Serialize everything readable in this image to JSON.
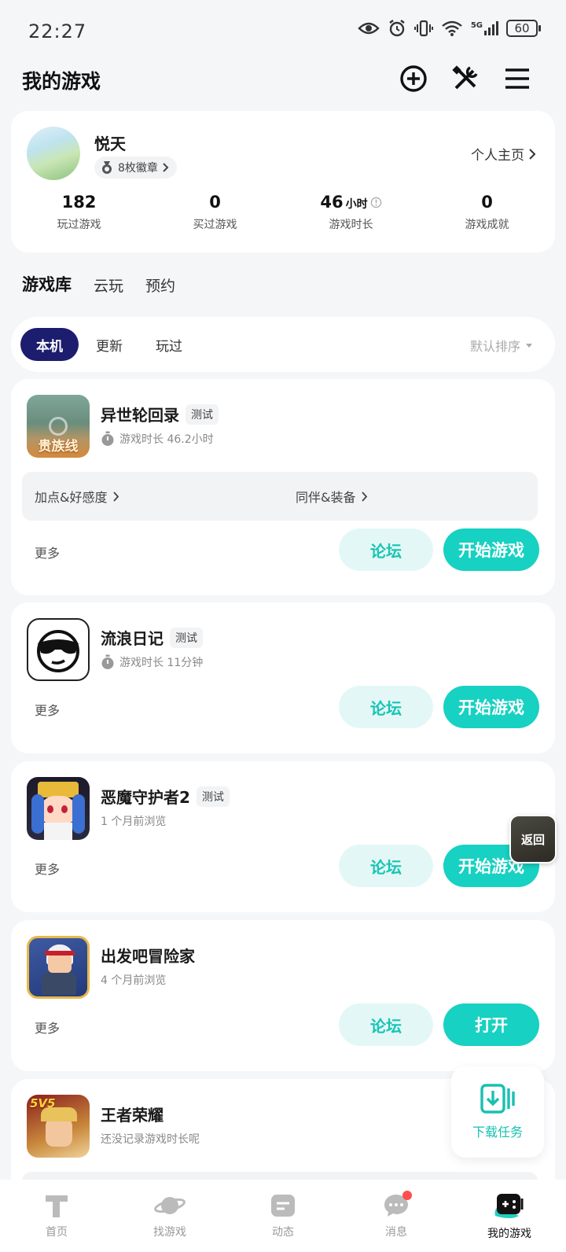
{
  "status_bar": {
    "time": "22:27",
    "battery": "60",
    "network": "5G"
  },
  "header": {
    "title": "我的游戏"
  },
  "profile": {
    "name": "悦天",
    "badge": "8枚徽章",
    "homepage": "个人主页",
    "stats": [
      {
        "value": "182",
        "unit": "",
        "label": "玩过游戏"
      },
      {
        "value": "0",
        "unit": "",
        "label": "买过游戏"
      },
      {
        "value": "46",
        "unit": "小时",
        "label": "游戏时长"
      },
      {
        "value": "0",
        "unit": "",
        "label": "游戏成就"
      }
    ]
  },
  "tabs": [
    "游戏库",
    "云玩",
    "预约"
  ],
  "filters": {
    "chips": [
      "本机",
      "更新",
      "玩过"
    ],
    "sort": "默认排序"
  },
  "games": [
    {
      "name": "异世轮回录",
      "tag": "测试",
      "sub": "游戏时长 46.2小时",
      "links": [
        "加点&好感度",
        "同伴&装备"
      ],
      "more": "更多",
      "forum": "论坛",
      "action": "开始游戏",
      "icon_text": "贵族线"
    },
    {
      "name": "流浪日记",
      "tag": "测试",
      "sub": "游戏时长 11分钟",
      "more": "更多",
      "forum": "论坛",
      "action": "开始游戏"
    },
    {
      "name": "恶魔守护者2",
      "tag": "测试",
      "sub": "1 个月前浏览",
      "more": "更多",
      "forum": "论坛",
      "action": "开始游戏"
    },
    {
      "name": "出发吧冒险家",
      "tag": "",
      "sub": "4 个月前浏览",
      "more": "更多",
      "forum": "论坛",
      "action": "打开"
    },
    {
      "name": "王者荣耀",
      "tag": "",
      "sub": "还没记录游戏时长呢",
      "icon_text": "5V5"
    }
  ],
  "floating": {
    "back": "返回",
    "download": "下载任务"
  },
  "nav": [
    {
      "label": "首页",
      "icon": "home-icon"
    },
    {
      "label": "找游戏",
      "icon": "planet-icon"
    },
    {
      "label": "动态",
      "icon": "feed-icon"
    },
    {
      "label": "消息",
      "icon": "message-icon"
    },
    {
      "label": "我的游戏",
      "icon": "gamepad-icon"
    }
  ],
  "colors": {
    "accent": "#17d1c2",
    "chip_active": "#1c1d6e",
    "notification": "#ff4d4f"
  }
}
